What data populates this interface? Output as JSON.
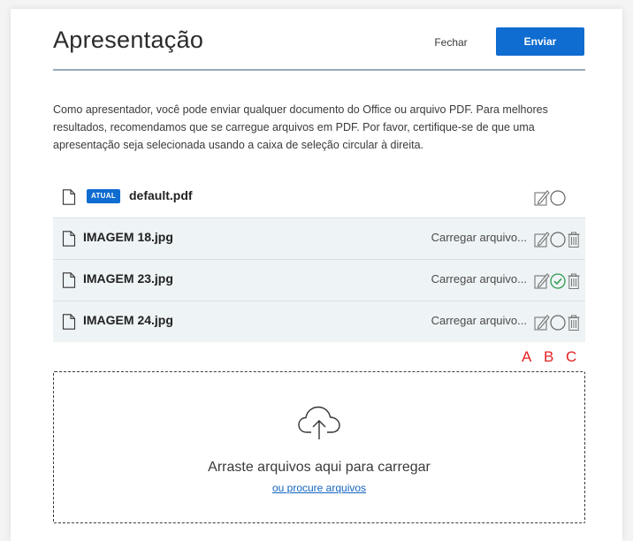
{
  "dialog": {
    "title": "Apresentação",
    "close_label": "Fechar",
    "send_label": "Enviar",
    "description": "Como apresentador, você pode enviar qualquer documento do Office ou arquivo PDF. Para melhores resultados, recomendamos que se carregue arquivos em PDF. Por favor, certifique-se de que uma apresentação seja selecionada usando a caixa de seleção circular à direita."
  },
  "files": [
    {
      "name": "default.pdf",
      "badge": "ATUAL",
      "status": "",
      "selected": false,
      "deletable": false
    },
    {
      "name": "IMAGEM 18.jpg",
      "badge": "",
      "status": "Carregar arquivo...",
      "selected": false,
      "deletable": true
    },
    {
      "name": "IMAGEM 23.jpg",
      "badge": "",
      "status": "Carregar arquivo...",
      "selected": true,
      "deletable": true
    },
    {
      "name": "IMAGEM 24.jpg",
      "badge": "",
      "status": "Carregar arquivo...",
      "selected": false,
      "deletable": true
    }
  ],
  "annotations": {
    "a": "A",
    "b": "B",
    "c": "C"
  },
  "dropzone": {
    "text": "Arraste arquivos aqui para carregar",
    "browse_link": "ou procure arquivos"
  },
  "colors": {
    "accent": "#0f6cd0",
    "selected_check": "#2e9b4f",
    "annotation": "#e52222",
    "row_shade": "#eef3f5"
  }
}
